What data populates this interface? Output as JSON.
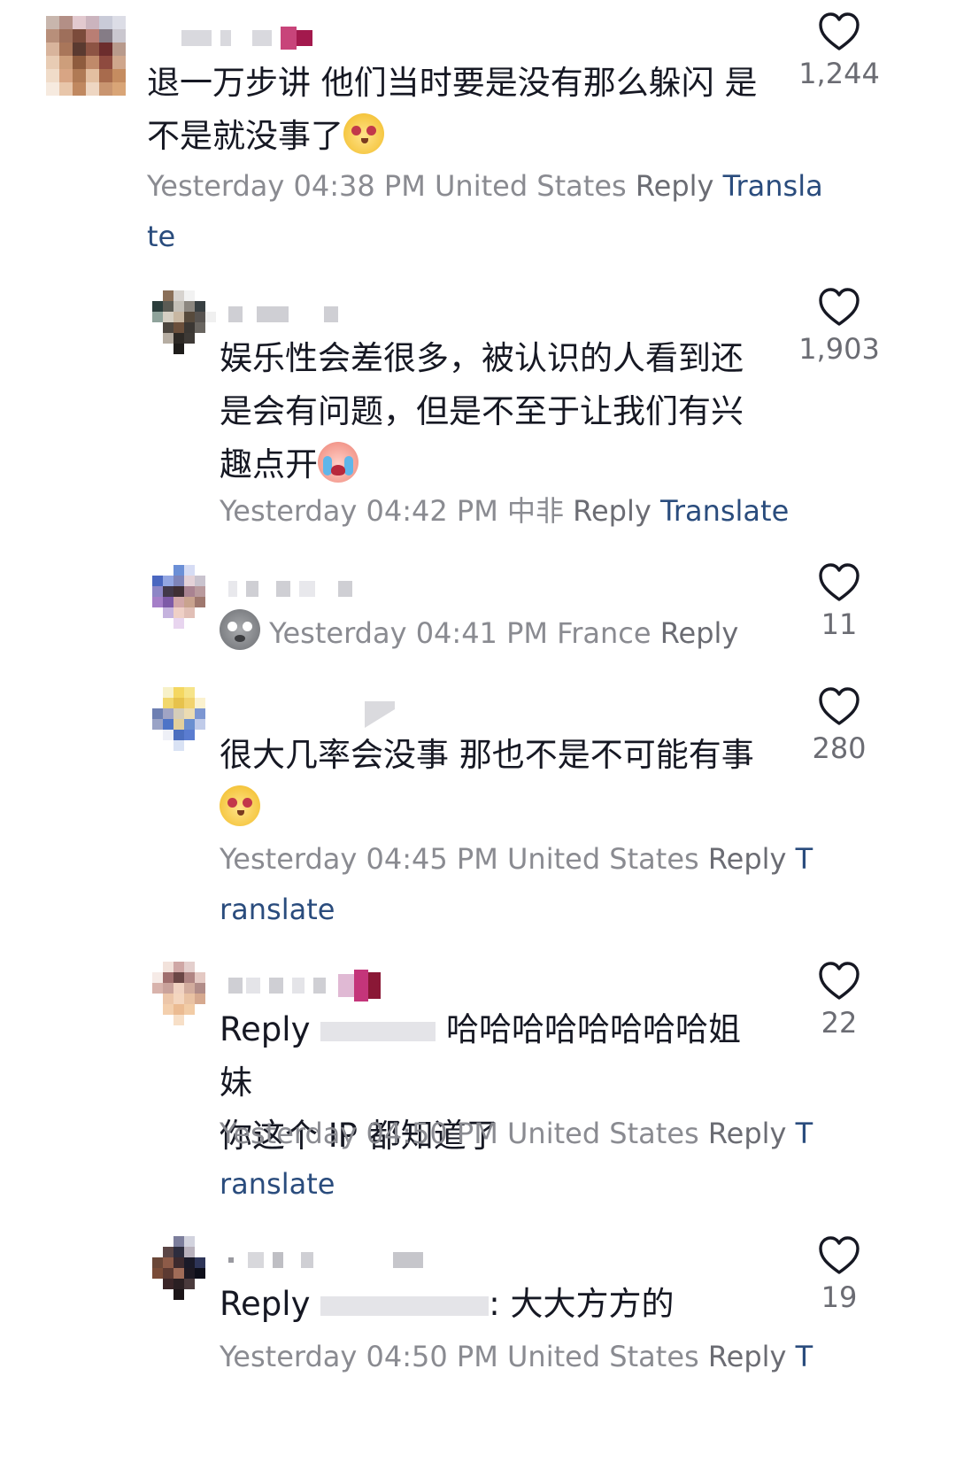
{
  "comments": [
    {
      "text": "退一万步讲 他们当时要是没有那么躲闪 是不是就没事了",
      "time": "Yesterday 04:38 PM",
      "location": "United States",
      "reply": "Reply",
      "translate": "Transla",
      "translate_wrap": "te",
      "likes": "1,244"
    },
    {
      "text": "娱乐性会差很多，被认识的人看到还是会有问题，但是不至于让我们有兴趣点开",
      "time": "Yesterday 04:42 PM",
      "location": "中非",
      "reply": "Reply",
      "translate": "Translate",
      "likes": "1,903"
    },
    {
      "time": "Yesterday 04:41 PM",
      "location": "France",
      "reply": "Reply",
      "likes": "11"
    },
    {
      "text": "很大几率会没事 那也不是不可能有事",
      "time": "Yesterday 04:45 PM",
      "location": "United States",
      "reply": "Reply",
      "translate": "T",
      "translate_wrap": "ranslate",
      "likes": "280"
    },
    {
      "reply_prefix": "Reply",
      "text": "哈哈哈哈哈哈哈哈姐妹",
      "text_line2": "你这个 IP 都知道了",
      "time": "Yesterday 04:50 PM",
      "location": "United States",
      "reply": "Reply",
      "translate": "T",
      "translate_wrap": "ranslate",
      "likes": "22"
    },
    {
      "reply_prefix": "Reply",
      "text": ": 大大方方的",
      "time": "Yesterday 04:50 PM",
      "location": "United States",
      "reply": "Reply",
      "translate": "T",
      "likes": "19"
    }
  ],
  "icons": {
    "like": "heart-outline-icon"
  },
  "colors": {
    "text": "#161823",
    "meta": "#8a8b91",
    "translate": "#2a4c7d",
    "icon": "#161823"
  }
}
